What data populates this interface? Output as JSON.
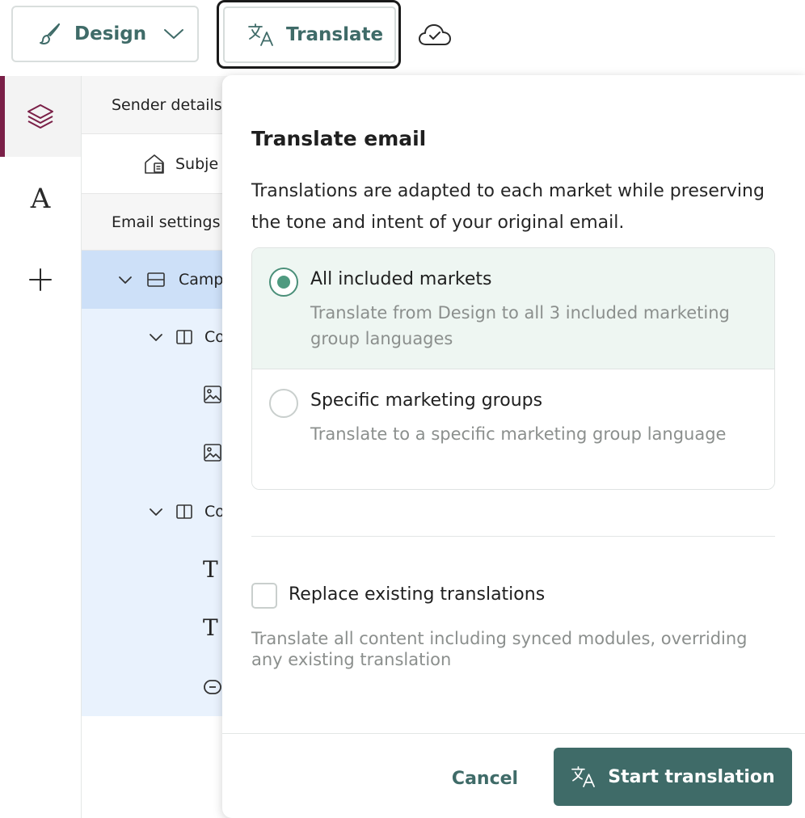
{
  "toolbar": {
    "design_label": "Design",
    "design_icon": "paintbrush-icon",
    "translate_label": "Translate",
    "translate_icon": "translate-icon",
    "cloud_icon": "cloud-check-icon"
  },
  "rail": {
    "items": [
      {
        "icon": "layers-icon",
        "active": true
      },
      {
        "icon": "typography-icon",
        "glyph": "A",
        "active": false
      },
      {
        "icon": "add-icon",
        "active": false
      }
    ]
  },
  "tree": {
    "sender_details": "Sender details",
    "subject": "Subje",
    "email_settings": "Email settings",
    "campaign": "Camp",
    "column_1": "Co",
    "column_2": "Co",
    "text_glyph": "T"
  },
  "dialog": {
    "title": "Translate email",
    "description": "Translations are adapted to each market while preserving the tone and intent of your original email.",
    "options": [
      {
        "title": "All included markets",
        "subtitle": "Translate from Design to all 3 included marketing group languages",
        "selected": true
      },
      {
        "title": "Specific marketing groups",
        "subtitle": "Translate to a specific marketing group language",
        "selected": false
      }
    ],
    "replace_label": "Replace existing translations",
    "replace_checked": false,
    "replace_help": "Translate all content including synced modules, overriding any existing translation",
    "cancel_label": "Cancel",
    "start_label": "Start translation"
  },
  "colors": {
    "accent": "#3f6b68",
    "selected_option_bg": "#eef6f2",
    "radio_selected": "#4f9a80",
    "rail_active_bar": "#7a1f47",
    "tree_selected_bg": "#cde0f8",
    "tree_bg": "#e9f2fd"
  }
}
